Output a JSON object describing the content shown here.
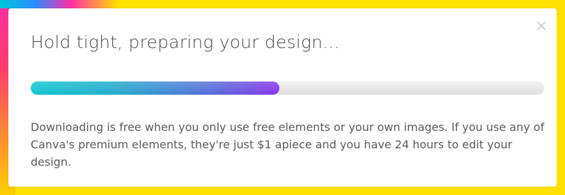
{
  "dialog": {
    "title": "Hold tight, preparing your design...",
    "close_glyph": "×",
    "progress_fraction": 0.485,
    "description": "Downloading is free when you only use free elements or your own images. If you use any of Canva's premium elements, they're just $1 apiece and you have 24 hours to edit your design."
  },
  "colors": {
    "progress_start": "#00c4cc",
    "progress_end": "#7d2ae8",
    "track": "#e2e2e2",
    "title_text": "#4a4a4a",
    "body_text": "#5a5a5a",
    "backdrop": "#ffe100"
  },
  "icons": {
    "close": "close-icon"
  }
}
